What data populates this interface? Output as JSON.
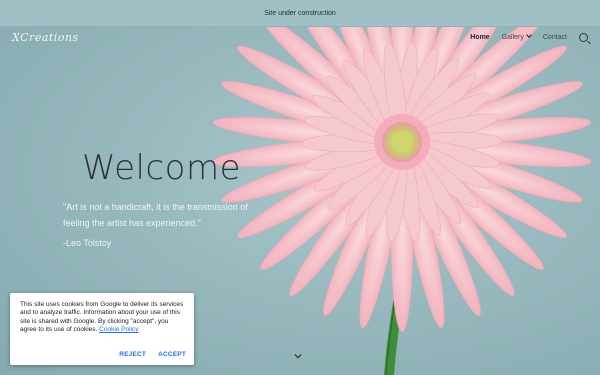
{
  "banner": {
    "text": "Site under construction"
  },
  "site": {
    "logo_text": "XCreations"
  },
  "nav": {
    "items": [
      {
        "label": "Home",
        "active": true
      },
      {
        "label": "Gallery",
        "has_dropdown": true
      },
      {
        "label": "Contact"
      }
    ],
    "search_icon": "search-icon"
  },
  "hero": {
    "title": "Welcome",
    "quote": "\"Art is not a handicraft, it is the transmission of feeling the artist has experienced.\"",
    "author": "-Leo Tolstoy",
    "scroll_icon": "chevron-down-icon",
    "image": "pink-gerbera-flower"
  },
  "cookie_notice": {
    "text": "This site uses cookies from Google to deliver its services and to analyze traffic. Information about your use of this site is shared with Google. By clicking \"accept\", you agree to its use of cookies.",
    "link_label": "Cookie Policy",
    "reject_label": "REJECT",
    "accept_label": "ACCEPT"
  },
  "colors": {
    "background": "#8fb3b9",
    "banner": "#9fc0c4",
    "accent_link": "#1a73e8",
    "flower_petal": "#f7cdd3",
    "flower_center": "#c9d36a",
    "stem": "#3c8a3a"
  }
}
